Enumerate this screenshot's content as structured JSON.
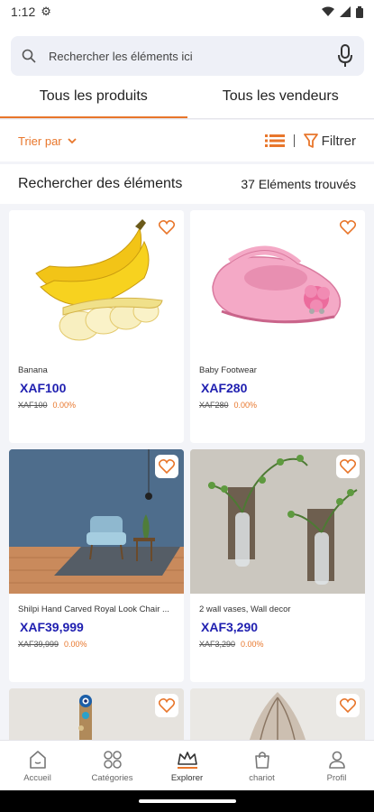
{
  "status_bar": {
    "time": "1:12"
  },
  "search": {
    "placeholder": "Rechercher les éléments ici"
  },
  "tabs": [
    {
      "label": "Tous les produits",
      "active": true
    },
    {
      "label": "Tous les vendeurs",
      "active": false
    }
  ],
  "toolbar": {
    "sort_label": "Trier par",
    "filter_label": "Filtrer"
  },
  "results": {
    "title": "Rechercher des éléments",
    "count": "37 Eléments trouvés"
  },
  "products": [
    {
      "name": "Banana",
      "price": "XAF100",
      "old_price": "XAF100",
      "discount": "0.00%",
      "image_icon": "banana-image"
    },
    {
      "name": "Baby Footwear",
      "price": "XAF280",
      "old_price": "XAF280",
      "discount": "0.00%",
      "image_icon": "baby-shoe-image"
    },
    {
      "name": "Shilpi Hand Carved Royal Look Chair ...",
      "price": "XAF39,999",
      "old_price": "XAF39,999",
      "discount": "0.00%",
      "image_icon": "chair-room-image"
    },
    {
      "name": "2 wall vases, Wall decor",
      "price": "XAF3,290",
      "old_price": "XAF3,290",
      "discount": "0.00%",
      "image_icon": "wall-vases-image"
    }
  ],
  "nav": [
    {
      "label": "Accueil",
      "icon": "home-icon"
    },
    {
      "label": "Catégories",
      "icon": "categories-icon"
    },
    {
      "label": "Explorer",
      "icon": "explore-icon"
    },
    {
      "label": "chariot",
      "icon": "cart-icon"
    },
    {
      "label": "Profil",
      "icon": "profile-icon"
    }
  ],
  "colors": {
    "accent": "#e8762b",
    "price": "#1f1fb0",
    "background": "#f3f4f8"
  }
}
